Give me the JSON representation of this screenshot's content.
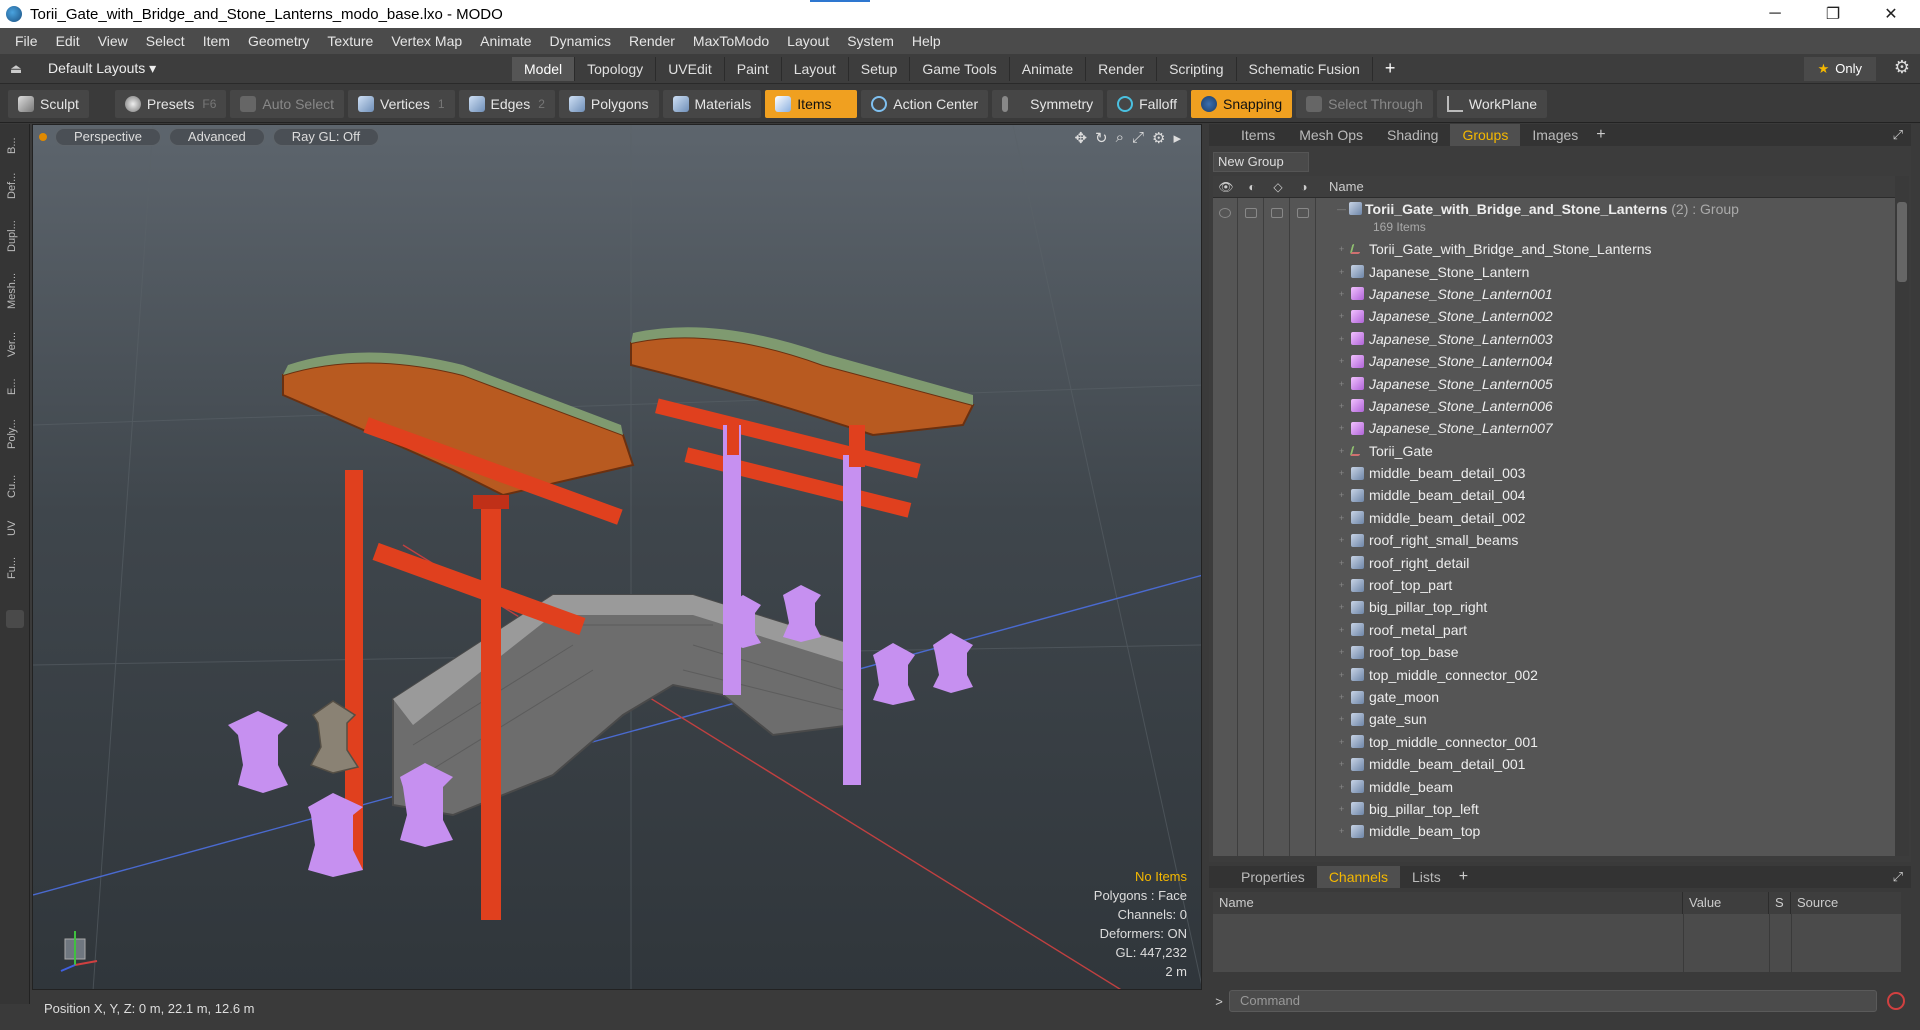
{
  "window": {
    "title": "Torii_Gate_with_Bridge_and_Stone_Lanterns_modo_base.lxo - MODO",
    "controls": [
      "─",
      "❐",
      "✕"
    ]
  },
  "menubar": [
    "File",
    "Edit",
    "View",
    "Select",
    "Item",
    "Geometry",
    "Texture",
    "Vertex Map",
    "Animate",
    "Dynamics",
    "Render",
    "MaxToModo",
    "Layout",
    "System",
    "Help"
  ],
  "layoutbar": {
    "layouts_label": "Default Layouts ▾",
    "tabs": [
      "Model",
      "Topology",
      "UVEdit",
      "Paint",
      "Layout",
      "Setup",
      "Game Tools",
      "Animate",
      "Render",
      "Scripting",
      "Schematic Fusion"
    ],
    "active_tab": "Model",
    "plus": "+",
    "only_label": "Only",
    "star": "★",
    "gear": "⚙"
  },
  "toolbar": {
    "sculpt": "Sculpt",
    "presets": "Presets",
    "presets_key": "F6",
    "auto_select": "Auto Select",
    "vertices": "Vertices",
    "vertices_count": "1",
    "edges": "Edges",
    "edges_count": "2",
    "polygons": "Polygons",
    "materials": "Materials",
    "items": "Items",
    "action_center": "Action Center",
    "symmetry": "Symmetry",
    "falloff": "Falloff",
    "snapping": "Snapping",
    "select_through": "Select Through",
    "workplane": "WorkPlane"
  },
  "leftstrip": [
    "B...",
    "Def...",
    "Dupl...",
    "Mesh...",
    "Ver...",
    "E...",
    "Poly...",
    "Cu...",
    "UV",
    "Fu..."
  ],
  "viewport": {
    "view_mode": "Perspective",
    "shading": "Advanced",
    "raygl": "Ray GL: Off",
    "icons": [
      "✥",
      "↻",
      "⌕",
      "⤢",
      "⚙",
      "▸"
    ],
    "stats": {
      "no_items": "No Items",
      "polygons": "Polygons : Face",
      "channels": "Channels: 0",
      "deformers": "Deformers: ON",
      "gl": "GL: 447,232",
      "scale": "2 m"
    }
  },
  "statusbar": {
    "position": "Position X, Y, Z:  0 m, 22.1 m, 12.6 m"
  },
  "groups_panel": {
    "tabs": [
      "Items",
      "Mesh Ops",
      "Shading",
      "Groups",
      "Images"
    ],
    "active_tab": "Groups",
    "new_group": "New Group",
    "column_name": "Name",
    "group": {
      "name": "Torii_Gate_with_Bridge_and_Stone_Lanterns",
      "suffix": " (2) : Group",
      "count": "169 Items"
    },
    "items": [
      {
        "label": "Torii_Gate_with_Bridge_and_Stone_Lanterns",
        "kind": "locator",
        "italic": false
      },
      {
        "label": "Japanese_Stone_Lantern",
        "kind": "mesh",
        "italic": false
      },
      {
        "label": "Japanese_Stone_Lantern001",
        "kind": "instance",
        "italic": true
      },
      {
        "label": "Japanese_Stone_Lantern002",
        "kind": "instance",
        "italic": true
      },
      {
        "label": "Japanese_Stone_Lantern003",
        "kind": "instance",
        "italic": true
      },
      {
        "label": "Japanese_Stone_Lantern004",
        "kind": "instance",
        "italic": true
      },
      {
        "label": "Japanese_Stone_Lantern005",
        "kind": "instance",
        "italic": true
      },
      {
        "label": "Japanese_Stone_Lantern006",
        "kind": "instance",
        "italic": true
      },
      {
        "label": "Japanese_Stone_Lantern007",
        "kind": "instance",
        "italic": true
      },
      {
        "label": "Torii_Gate",
        "kind": "locator",
        "italic": false
      },
      {
        "label": "middle_beam_detail_003",
        "kind": "mesh",
        "italic": false
      },
      {
        "label": "middle_beam_detail_004",
        "kind": "mesh",
        "italic": false
      },
      {
        "label": "middle_beam_detail_002",
        "kind": "mesh",
        "italic": false
      },
      {
        "label": "roof_right_small_beams",
        "kind": "mesh",
        "italic": false
      },
      {
        "label": "roof_right_detail",
        "kind": "mesh",
        "italic": false
      },
      {
        "label": "roof_top_part",
        "kind": "mesh",
        "italic": false
      },
      {
        "label": "big_pillar_top_right",
        "kind": "mesh",
        "italic": false
      },
      {
        "label": "roof_metal_part",
        "kind": "mesh",
        "italic": false
      },
      {
        "label": "roof_top_base",
        "kind": "mesh",
        "italic": false
      },
      {
        "label": "top_middle_connector_002",
        "kind": "mesh",
        "italic": false
      },
      {
        "label": "gate_moon",
        "kind": "mesh",
        "italic": false
      },
      {
        "label": "gate_sun",
        "kind": "mesh",
        "italic": false
      },
      {
        "label": "top_middle_connector_001",
        "kind": "mesh",
        "italic": false
      },
      {
        "label": "middle_beam_detail_001",
        "kind": "mesh",
        "italic": false
      },
      {
        "label": "middle_beam",
        "kind": "mesh",
        "italic": false
      },
      {
        "label": "big_pillar_top_left",
        "kind": "mesh",
        "italic": false
      },
      {
        "label": "middle_beam_top",
        "kind": "mesh",
        "italic": false
      }
    ]
  },
  "channels_panel": {
    "tabs": [
      "Properties",
      "Channels",
      "Lists"
    ],
    "active_tab": "Channels",
    "columns": [
      "Name",
      "Value",
      "S",
      "Source"
    ]
  },
  "command": {
    "prompt": ">",
    "placeholder": "Command"
  },
  "colors": {
    "accent": "#f5b800",
    "items_button": "#f0a020",
    "selection_purple": "#c690f0",
    "torii_red": "#e0401e"
  }
}
